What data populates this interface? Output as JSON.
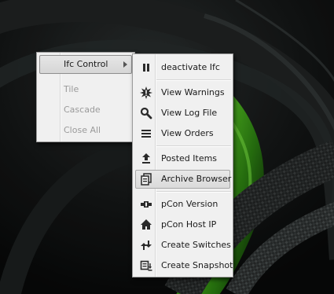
{
  "left_menu": {
    "items": [
      {
        "label": "Ifc Control",
        "has_submenu": true,
        "state": "highlighted"
      },
      {
        "label": "Tile",
        "state": "disabled"
      },
      {
        "label": "Cascade",
        "state": "disabled"
      },
      {
        "label": "Close All",
        "state": "disabled"
      }
    ]
  },
  "submenu": {
    "items": [
      {
        "label": "deactivate Ifc",
        "icon": "pause-icon"
      },
      {
        "label": "View Warnings",
        "icon": "warning-burst-icon"
      },
      {
        "label": "View Log File",
        "icon": "magnifier-icon"
      },
      {
        "label": "View Orders",
        "icon": "list-lines-icon"
      },
      {
        "label": "Posted Items",
        "icon": "upload-icon"
      },
      {
        "label": "Archive Browser",
        "icon": "archive-icon",
        "state": "hovered"
      },
      {
        "label": "pCon Version",
        "icon": "connector-icon"
      },
      {
        "label": "pCon Host IP",
        "icon": "home-icon"
      },
      {
        "label": "Create Switches",
        "icon": "switch-arrows-icon"
      },
      {
        "label": "Create Snapshot",
        "icon": "snapshot-icon"
      }
    ]
  },
  "colors": {
    "menu_bg": "#f0f0f0",
    "disabled_text": "#9a9a9a",
    "wallpaper_accent": "#3fa41a"
  }
}
